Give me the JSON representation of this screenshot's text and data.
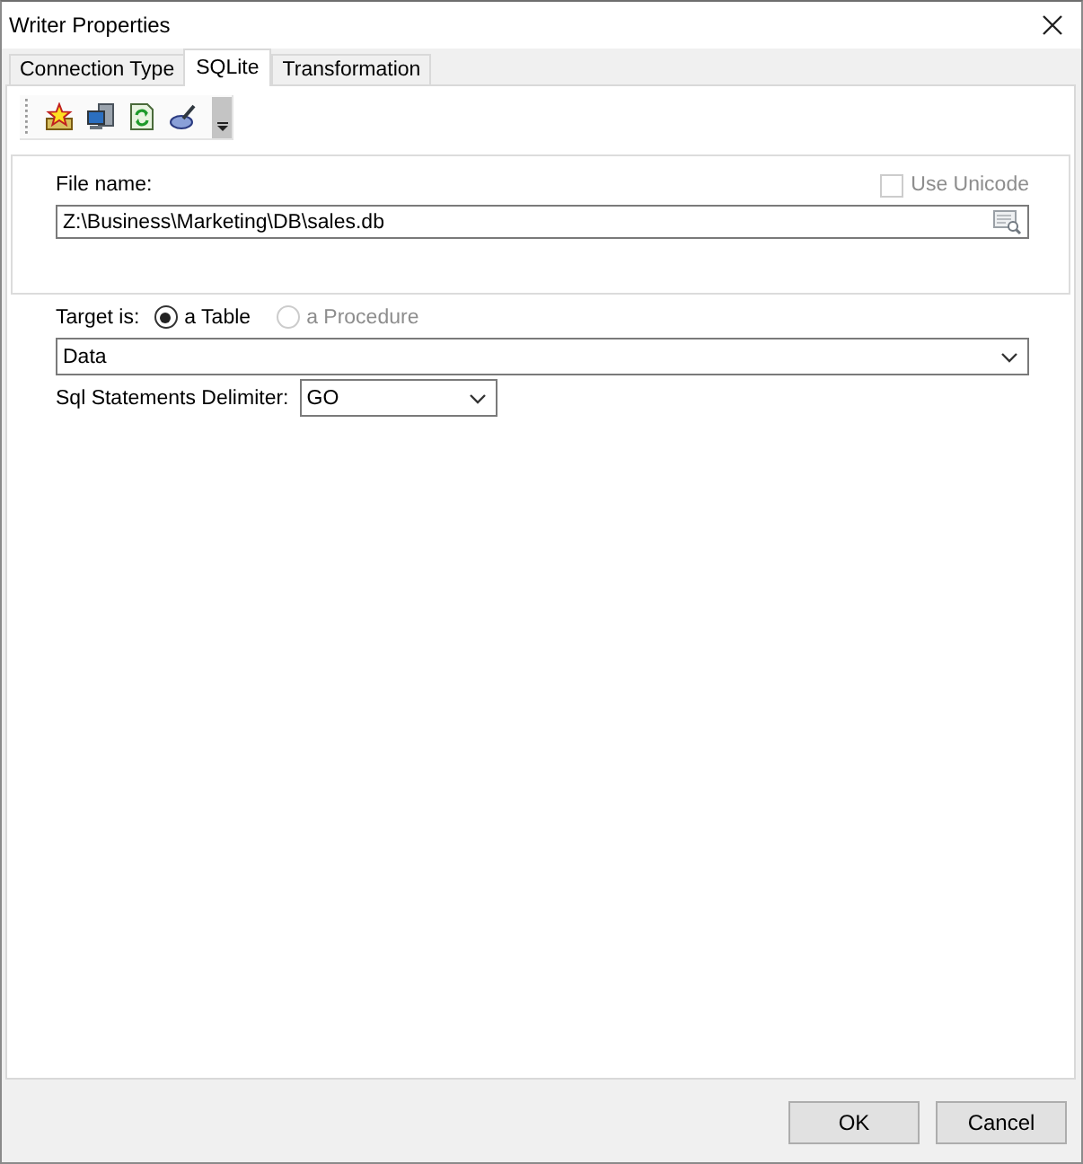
{
  "window": {
    "title": "Writer Properties"
  },
  "tabs": [
    {
      "label": "Connection Type",
      "selected": false
    },
    {
      "label": "SQLite",
      "selected": true
    },
    {
      "label": "Transformation",
      "selected": false
    }
  ],
  "file_panel": {
    "label": "File name:",
    "use_unicode": {
      "label": "Use Unicode",
      "checked": false,
      "disabled": true
    },
    "file_name": {
      "value": "Z:\\Business\\Marketing\\DB\\sales.db"
    }
  },
  "target": {
    "label": "Target is:",
    "options": [
      {
        "label": "a Table",
        "selected": true,
        "disabled": false
      },
      {
        "label": "a Procedure",
        "selected": false,
        "disabled": true
      }
    ]
  },
  "table_select": {
    "value": "Data"
  },
  "delimiter": {
    "label": "Sql Statements Delimiter:",
    "value": "GO"
  },
  "buttons": [
    {
      "label": "OK"
    },
    {
      "label": "Cancel"
    }
  ]
}
